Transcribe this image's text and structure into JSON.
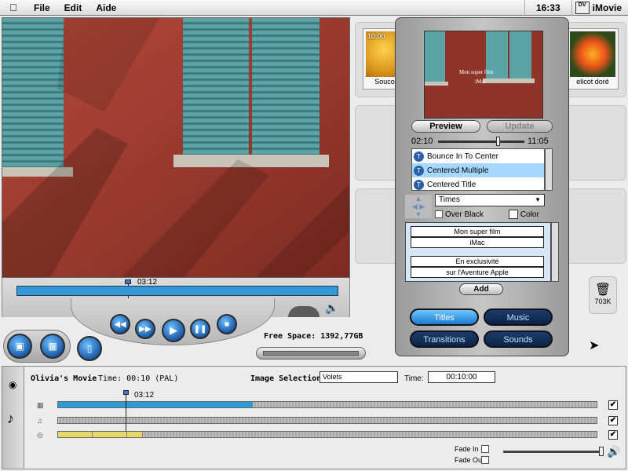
{
  "menubar": {
    "apple_symbol": "",
    "items": [
      "File",
      "Edit",
      "Aide"
    ],
    "clock": "16:33",
    "app_icon_text": "DV",
    "app_name": "iMovie"
  },
  "viewer": {
    "current_time": "03:12",
    "free_space_label": "Free Space: 1392,77GB"
  },
  "shelf": {
    "clips": [
      {
        "name": "Soucoup",
        "duration": "10:00"
      },
      {
        "name": "elicot doré",
        "duration": ""
      }
    ],
    "trash_size": "703K"
  },
  "titles_panel": {
    "preview_text_1": "Mon super film",
    "preview_text_2": "iMac",
    "preview_button": "Preview",
    "update_button": "Update",
    "slider_min": "02:10",
    "slider_max": "11:05",
    "titles": [
      {
        "name": "Bounce In To Center",
        "selected": false
      },
      {
        "name": "Centered Multiple",
        "selected": true
      },
      {
        "name": "Centered Title",
        "selected": false
      }
    ],
    "font": "Times",
    "over_black_label": "Over Black",
    "color_label": "Color",
    "text_lines": [
      "Mon super film",
      "iMac",
      "En exclusivité",
      "sur l'Aventure Apple"
    ],
    "add_button": "Add",
    "categories": [
      {
        "label": "Titles",
        "active": true
      },
      {
        "label": "Music",
        "active": false
      },
      {
        "label": "Transitions",
        "active": false
      },
      {
        "label": "Sounds",
        "active": false
      }
    ]
  },
  "timeline": {
    "movie_name": "Olivia's Movie",
    "time_text": "Time: 00:10 (PAL)",
    "image_selection_label": "Image Selection:",
    "image_selection_value": "Volets",
    "time_label": "Time:",
    "time_value": "00:10:00",
    "playhead_time": "03:12",
    "fade_in_label": "Fade In",
    "fade_out_label": "Fade Out",
    "track_checks": [
      "✔",
      "✔",
      "✔"
    ]
  },
  "colors": {
    "accent_blue": "#2e9bd6",
    "wall_red": "#9b3b2e",
    "shutter_teal": "#4f9aa0",
    "audio_yellow": "#e8d868"
  }
}
